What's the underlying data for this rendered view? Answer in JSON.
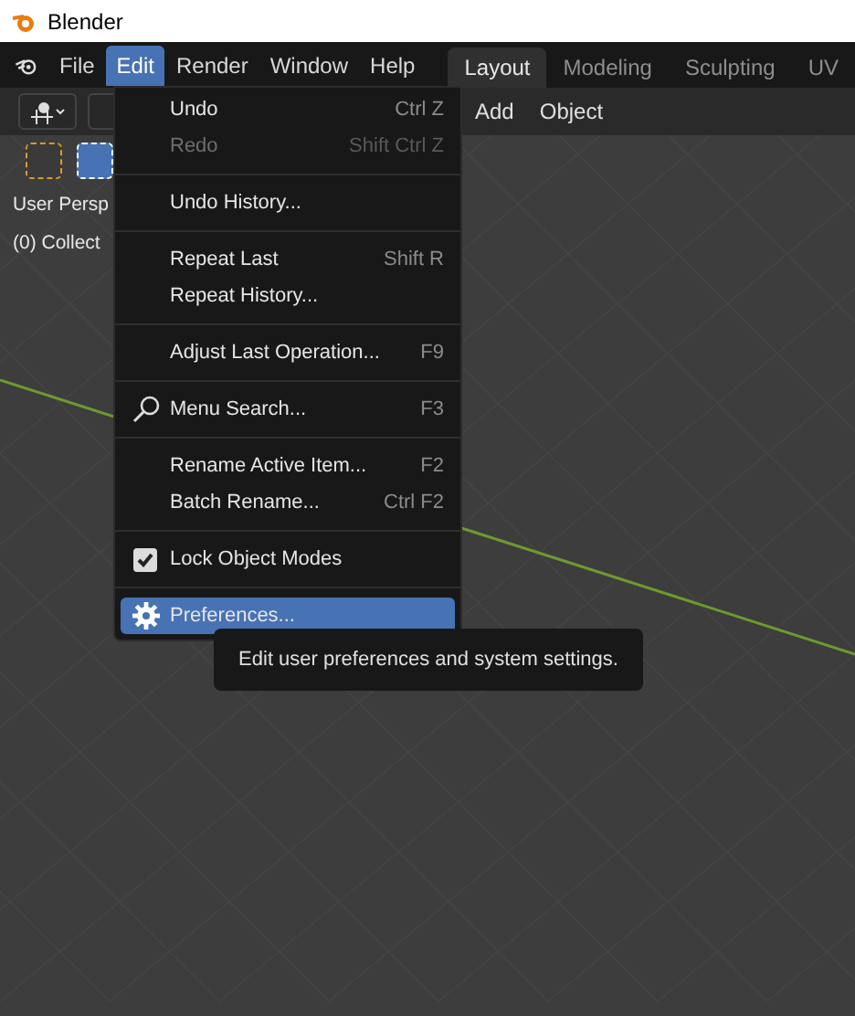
{
  "window": {
    "title": "Blender"
  },
  "menubar": [
    {
      "label": "File",
      "selected": false
    },
    {
      "label": "Edit",
      "selected": true
    },
    {
      "label": "Render",
      "selected": false
    },
    {
      "label": "Window",
      "selected": false
    },
    {
      "label": "Help",
      "selected": false
    }
  ],
  "workspace_tabs": [
    {
      "label": "Layout",
      "selected": true
    },
    {
      "label": "Modeling",
      "selected": false
    },
    {
      "label": "Sculpting",
      "selected": false
    },
    {
      "label": "UV",
      "selected": false
    }
  ],
  "header_menus": [
    "Add",
    "Object"
  ],
  "viewport": {
    "overlay_lines": [
      "User Persp",
      "(0) Collect"
    ]
  },
  "edit_menu": [
    {
      "kind": "item",
      "label": "Undo",
      "shortcut": "Ctrl Z",
      "disabled": false,
      "selected": false
    },
    {
      "kind": "item",
      "label": "Redo",
      "shortcut": "Shift Ctrl Z",
      "disabled": true,
      "selected": false
    },
    {
      "kind": "separator"
    },
    {
      "kind": "item",
      "label": "Undo History...",
      "disabled": false,
      "selected": false
    },
    {
      "kind": "separator"
    },
    {
      "kind": "item",
      "label": "Repeat Last",
      "shortcut": "Shift R",
      "disabled": false,
      "selected": false
    },
    {
      "kind": "item",
      "label": "Repeat History...",
      "disabled": false,
      "selected": false
    },
    {
      "kind": "separator"
    },
    {
      "kind": "item",
      "label": "Adjust Last Operation...",
      "shortcut": "F9",
      "disabled": false,
      "selected": false
    },
    {
      "kind": "separator"
    },
    {
      "kind": "search",
      "label": "Menu Search...",
      "shortcut": "F3",
      "disabled": false,
      "selected": false
    },
    {
      "kind": "separator"
    },
    {
      "kind": "item",
      "label": "Rename Active Item...",
      "shortcut": "F2",
      "disabled": false,
      "selected": false
    },
    {
      "kind": "item",
      "label": "Batch Rename...",
      "shortcut": "Ctrl F2",
      "disabled": false,
      "selected": false
    },
    {
      "kind": "separator"
    },
    {
      "kind": "checkbox",
      "label": "Lock Object Modes",
      "checked": true,
      "disabled": false,
      "selected": false
    },
    {
      "kind": "separator"
    },
    {
      "kind": "settings",
      "label": "Preferences...",
      "disabled": false,
      "selected": true
    }
  ],
  "tooltip": "Edit user preferences and system settings."
}
